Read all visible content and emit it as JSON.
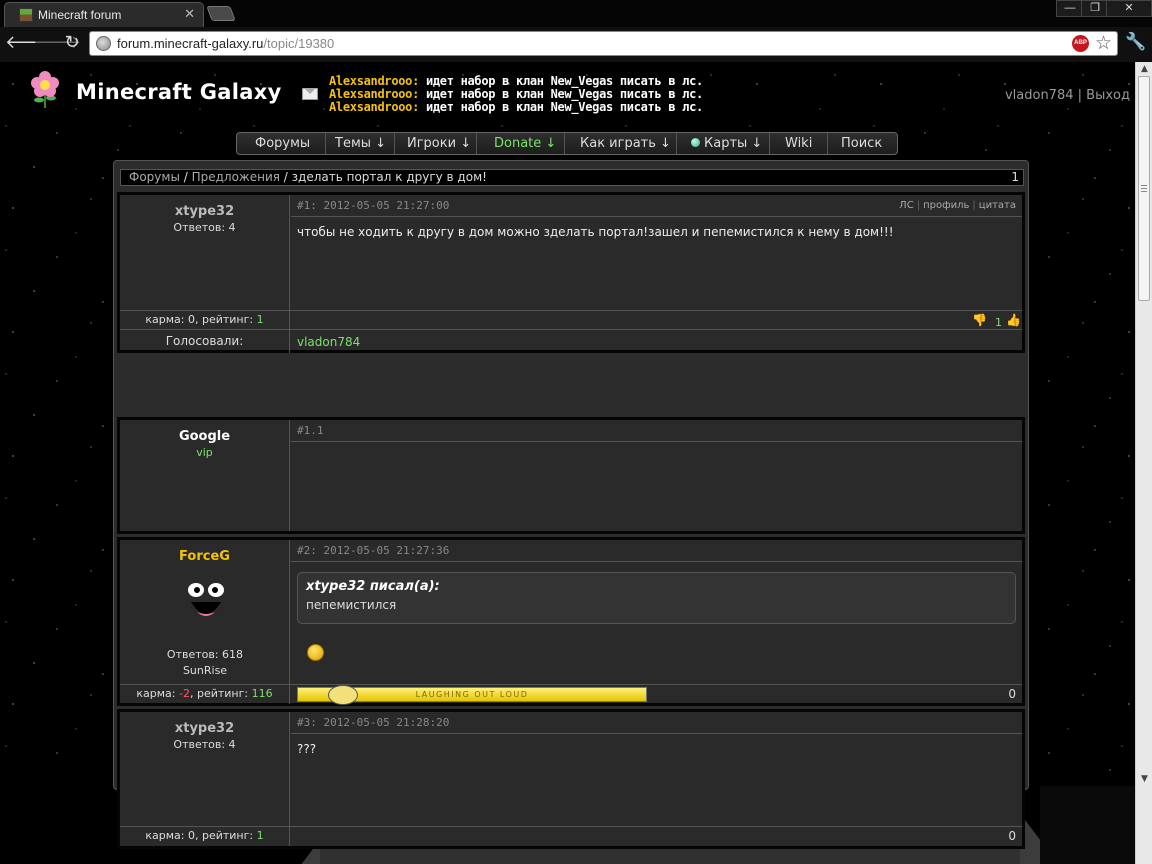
{
  "browser": {
    "tab_title": "Minecraft forum",
    "tab_close": "✕",
    "url_host": "forum.minecraft-galaxy.ru",
    "url_path": "/topic/19380",
    "abp": "ABP",
    "win_min": "—",
    "win_max": "❐",
    "win_close": "✕"
  },
  "header": {
    "site_title": "Minecraft Galaxy",
    "shouts": [
      {
        "who": "Alexsandrooo:",
        "text": " идет набор в клан New_Vegas писать в лс."
      },
      {
        "who": "Alexsandrooo:",
        "text": " идет набор в клан New_Vegas писать в лс."
      },
      {
        "who": "Alexsandrooo:",
        "text": " идет набор в клан New_Vegas писать в лс."
      }
    ],
    "username": "vladon784",
    "divider": "|",
    "logout": "Выход"
  },
  "nav": {
    "forums": "Форумы",
    "topics": "Темы ↓",
    "players": "Игроки ↓",
    "donate": "Donate ↓",
    "how_to_play": "Как играть ↓",
    "maps": "Карты ↓",
    "wiki": "Wiki",
    "search": "Поиск"
  },
  "breadcrumb": {
    "root": "Форумы",
    "sep": " / ",
    "section": "Предложения",
    "topic": "зделать портал к другу в дом!",
    "page": "1"
  },
  "posts": [
    {
      "author": "xtype32",
      "replies": "Ответов: 4",
      "meta": "#1: 2012-05-05 21:27:00",
      "actions": [
        "ЛС",
        "профиль",
        "цитата"
      ],
      "sep": "|",
      "body": "чтобы не ходить к другу в дом можно зделать портал!зашел и пепемистился к нему в дом!!!",
      "karma_label": "карма: 0, рейтинг: ",
      "rating": "1",
      "score": "1",
      "voters_label": "Голосовали:",
      "voters": "vladon784"
    },
    {
      "author": "Google",
      "role": "vip",
      "meta": "#1.1"
    },
    {
      "author": "ForceG",
      "replies": "Ответов: 618",
      "clan": "SunRise",
      "meta": "#2: 2012-05-05 21:27:36",
      "quote_head": "xtype32 писал(а):",
      "quote_text": "пепемистился",
      "karma_prefix": "карма: ",
      "karma_value": "-2",
      "karma_mid": ", рейтинг: ",
      "rating": "116",
      "banner": "LAUGHING OUT LOUD",
      "score": "0"
    },
    {
      "author": "xtype32",
      "replies": "Ответов: 4",
      "meta": "#3: 2012-05-05 21:28:20",
      "body": "???",
      "karma_label": "карма: 0, рейтинг: ",
      "rating": "1",
      "score": "0"
    }
  ]
}
